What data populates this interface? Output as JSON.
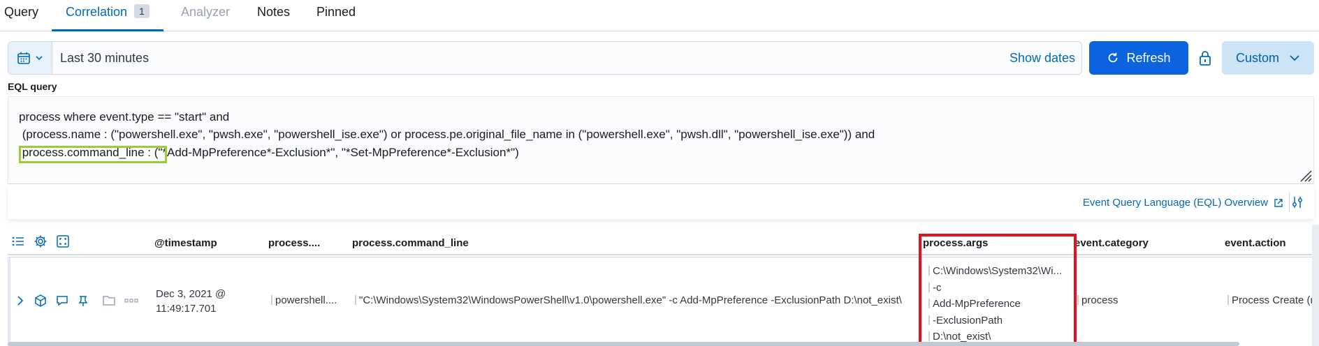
{
  "tabs": [
    {
      "label": "Query"
    },
    {
      "label": "Correlation",
      "badge": "1"
    },
    {
      "label": "Analyzer"
    },
    {
      "label": "Notes"
    },
    {
      "label": "Pinned"
    }
  ],
  "datepicker": {
    "range": "Last 30 minutes",
    "show_dates": "Show dates",
    "refresh": "Refresh",
    "custom": "Custom"
  },
  "eql": {
    "label": "EQL query",
    "lines": [
      "process where event.type == \"start\" and",
      " (process.name : (\"powershell.exe\", \"pwsh.exe\", \"powershell_ise.exe\") or process.pe.original_file_name in (\"powershell.exe\", \"pwsh.dll\", \"powershell_ise.exe\")) and",
      " process.command_line : (\"*Add-MpPreference*-Exclusion*\", \"*Set-MpPreference*-Exclusion*\")"
    ],
    "overview_link": "Event Query Language (EQL) Overview"
  },
  "grid": {
    "columns": [
      "@timestamp",
      "process....",
      "process.command_line",
      "process.args",
      "event.category",
      "event.action"
    ],
    "row": {
      "timestamp_date": "Dec 3, 2021 @",
      "timestamp_time": "11:49:17.701",
      "process_name": "powershell....",
      "command_line": "\"C:\\Windows\\System32\\WindowsPowerShell\\v1.0\\powershell.exe\" -c Add-MpPreference -ExclusionPath D:\\not_exist\\",
      "args": [
        "C:\\Windows\\System32\\Wi...",
        "-c",
        "Add-MpPreference",
        "-ExclusionPath",
        "D:\\not_exist\\"
      ],
      "event_category": "process",
      "event_action": "Process Create (r"
    }
  },
  "colors": {
    "accent": "#006bb8",
    "refresh_bg": "#0b64dd",
    "highlight_green": "#9acd32",
    "highlight_red": "#e0141e"
  }
}
